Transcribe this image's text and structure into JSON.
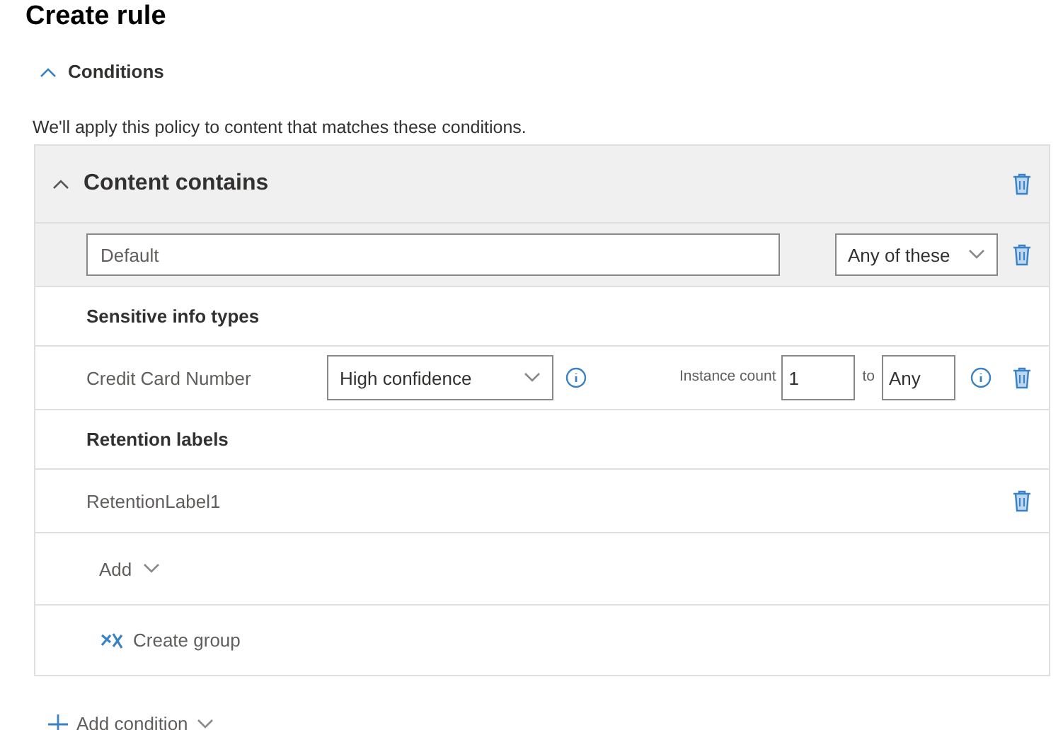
{
  "title": "Create rule",
  "conditions": {
    "label": "Conditions",
    "expanded": true,
    "description": "We'll apply this policy to content that matches these conditions."
  },
  "content_contains": {
    "title": "Content contains",
    "expanded": true,
    "group_name": "Default",
    "match": "Any of these",
    "sections": [
      {
        "heading": "Sensitive info types",
        "items": [
          {
            "kind": "sit",
            "name": "Credit Card Number",
            "confidence": "High confidence",
            "instance_label": "Instance count",
            "min": "1",
            "to": "to",
            "max": "Any"
          }
        ]
      },
      {
        "heading": "Retention labels",
        "items": [
          {
            "kind": "label",
            "name": "RetentionLabel1"
          }
        ]
      }
    ],
    "add": "Add",
    "create_group": "Create group"
  },
  "add_condition": "Add condition"
}
